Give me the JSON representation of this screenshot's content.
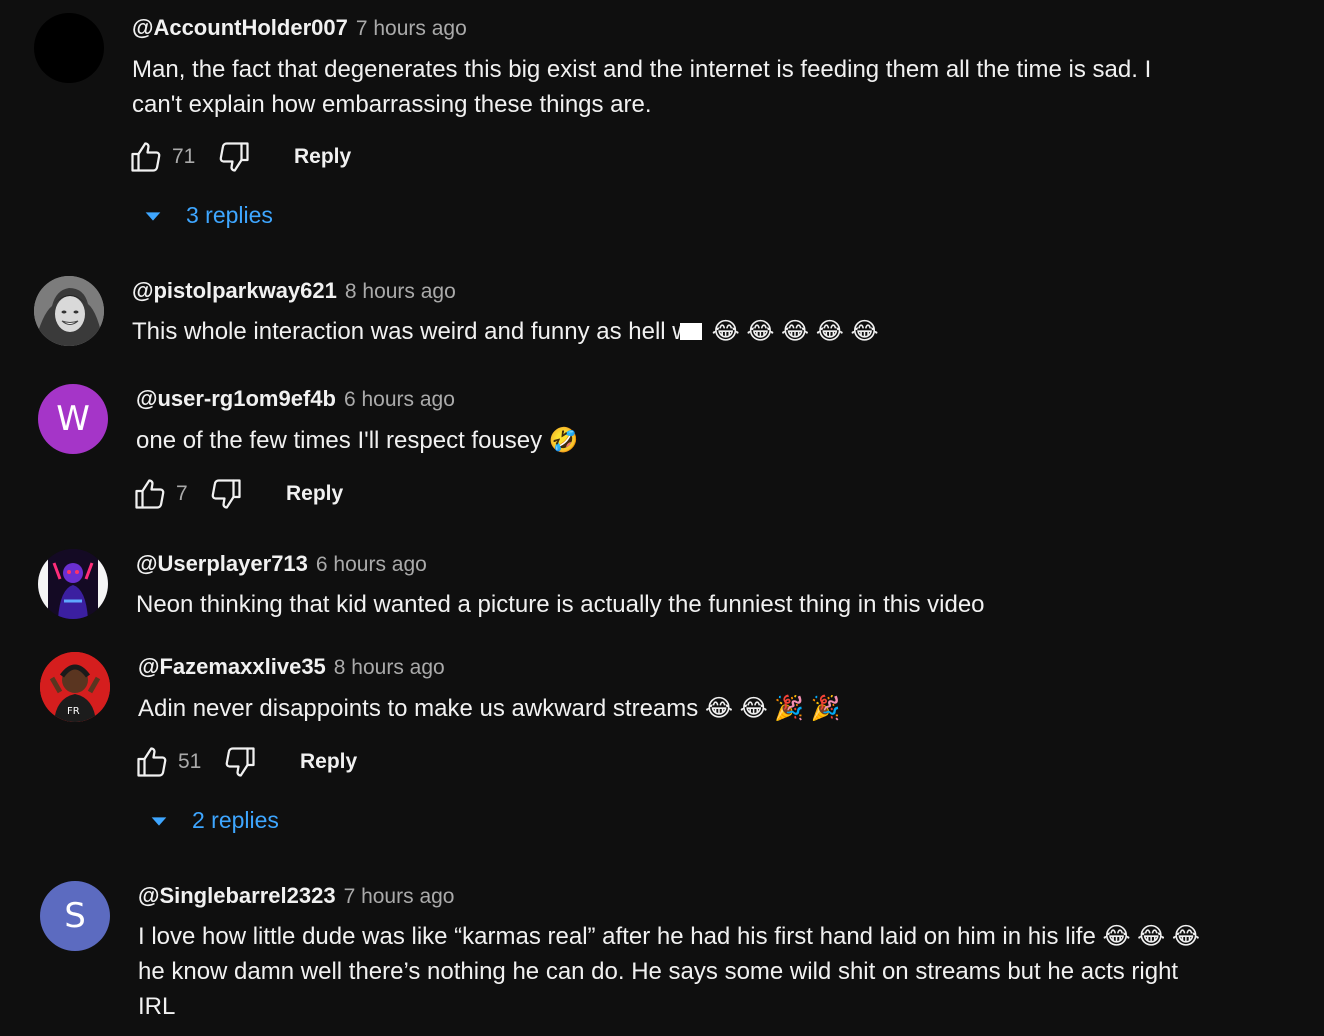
{
  "colors": {
    "background": "#0f0f0f",
    "text_primary": "#f1f1f1",
    "text_secondary": "#aaaaaa",
    "link_blue": "#3ea6ff",
    "avatar_w": "#a535c8",
    "avatar_s": "#5c6bc0"
  },
  "comments": [
    {
      "author": "@AccountHolder007",
      "time": "7 hours ago",
      "text": "Man, the fact that degenerates this big exist and the internet is feeding them all the time is sad. I\ncan't explain how embarrassing these things are.",
      "likes": "71",
      "reply_label": "Reply",
      "replies_label": "3 replies",
      "avatar_icon": "black-circle-avatar"
    },
    {
      "author": "@pistolparkway621",
      "time": "8 hours ago",
      "text": "This whole interaction was weird and funny as hell w",
      "emoji": "😂 😂 😂 😂 😂",
      "avatar_icon": "grayscale-face-photo-avatar"
    },
    {
      "author": "@user-rg1om9ef4b",
      "time": "6 hours ago",
      "text": "one of the few times I'll respect fousey",
      "emoji": "🤣",
      "likes": "7",
      "reply_label": "Reply",
      "avatar_letter": "W"
    },
    {
      "author": "@Userplayer713",
      "time": "6 hours ago",
      "text": "Neon thinking that kid wanted a picture is actually the funniest thing in this video",
      "avatar_icon": "purple-neon-figure-avatar"
    },
    {
      "author": "@Fazemaxxlive35",
      "time": "8 hours ago",
      "text": "Adin never disappoints to make us awkward streams",
      "emoji": "😂 😂 🎉 🎉",
      "likes": "51",
      "reply_label": "Reply",
      "replies_label": "2 replies",
      "avatar_icon": "red-background-person-avatar"
    },
    {
      "author": "@Singlebarrel2323",
      "time": "7 hours ago",
      "text": "I love how little dude was like “karmas real” after he had his first hand laid on him in his life",
      "emoji": "😂 😂 😂",
      "text2": "he know damn well there’s nothing he can do. He says some wild shit on streams but he acts right\nIRL",
      "avatar_letter": "S"
    }
  ]
}
